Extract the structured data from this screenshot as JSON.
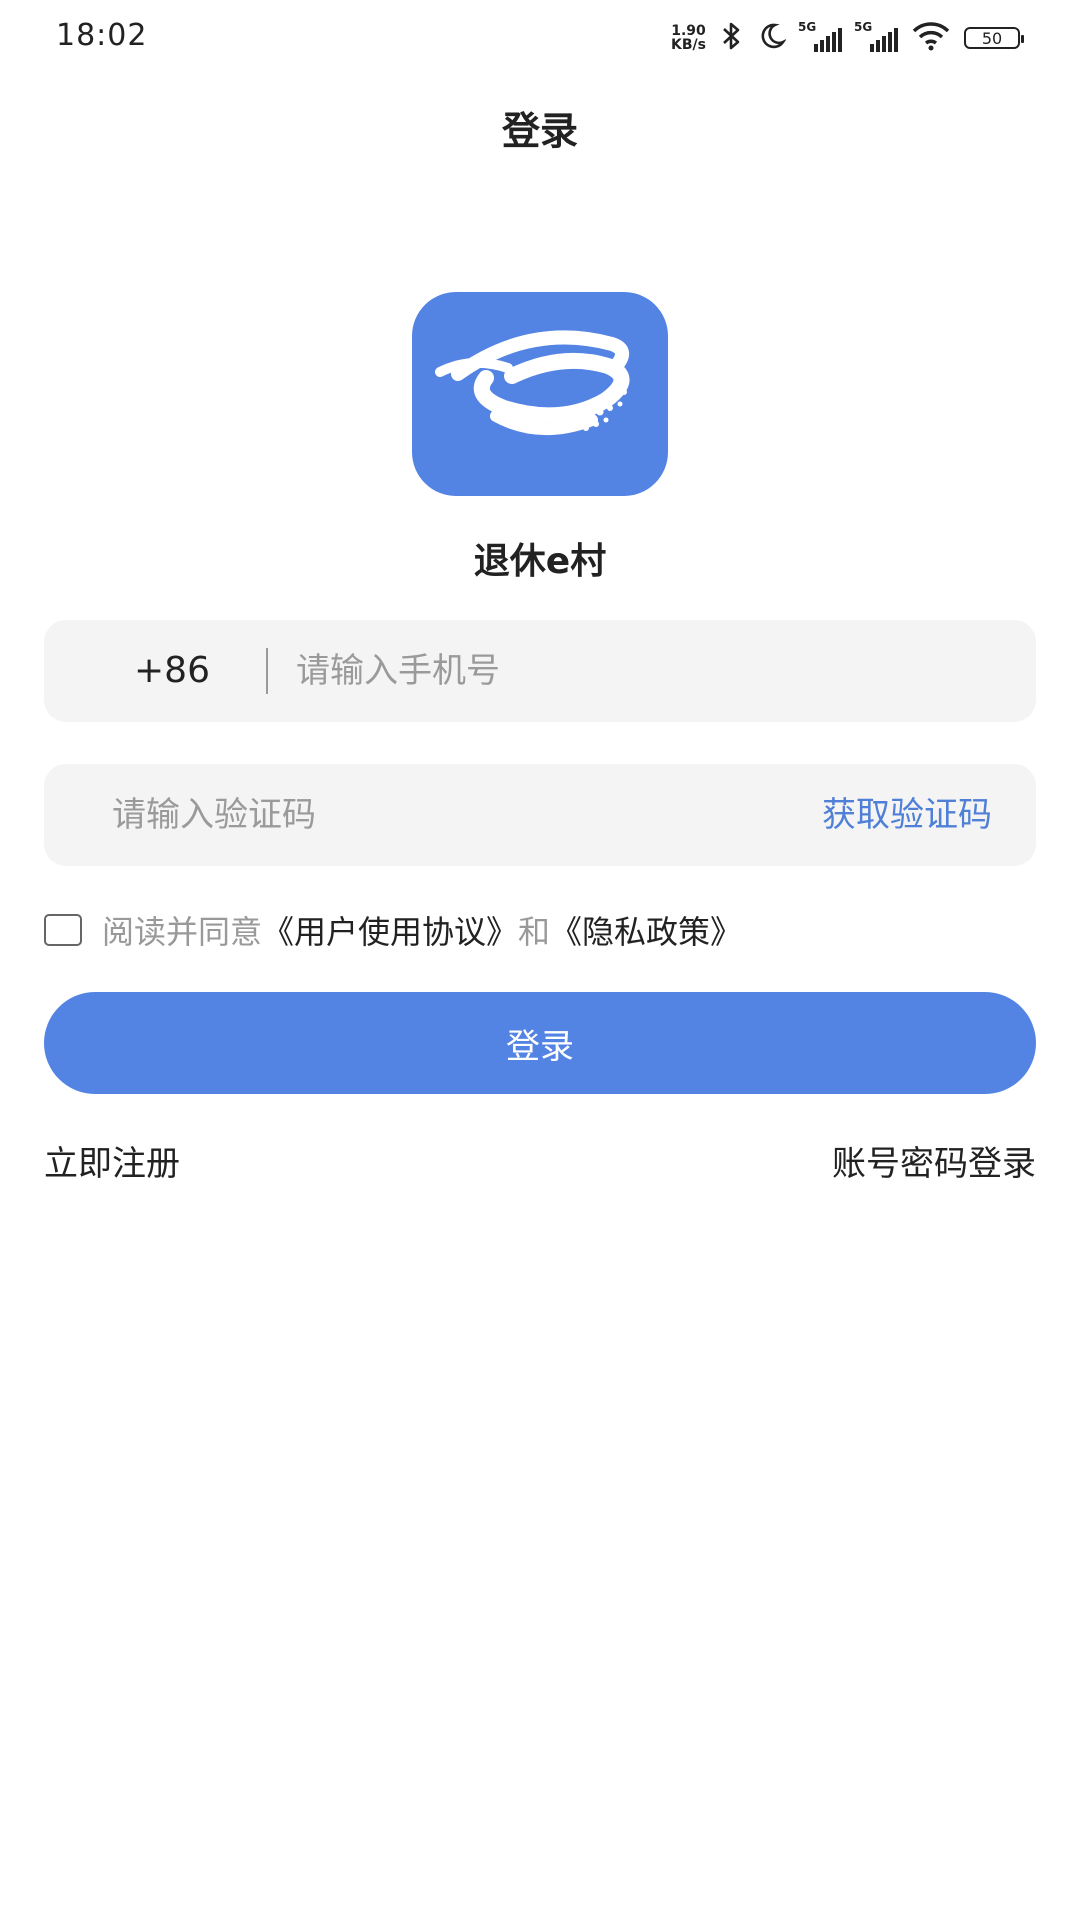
{
  "status_bar": {
    "time": "18:02",
    "net_speed_value": "1.90",
    "net_speed_unit": "KB/s",
    "signal_1_label": "5G",
    "signal_2_label": "5G",
    "battery": "50"
  },
  "header": {
    "title": "登录"
  },
  "app": {
    "name": "退休e村",
    "brand_color": "#5384e4",
    "logo_icon": "app-logo-icon"
  },
  "phone": {
    "prefix": "+86",
    "placeholder": "请输入手机号"
  },
  "code": {
    "placeholder": "请输入验证码",
    "get_code_label": "获取验证码",
    "link_color": "#4f7fd6"
  },
  "agreement": {
    "checked": false,
    "text_prefix": "阅读并同意",
    "user_agreement": "《用户使用协议》",
    "conjunction": "和",
    "privacy_policy": "《隐私政策》"
  },
  "login_button": {
    "label": "登录"
  },
  "footer": {
    "register": "立即注册",
    "password_login": "账号密码登录"
  }
}
